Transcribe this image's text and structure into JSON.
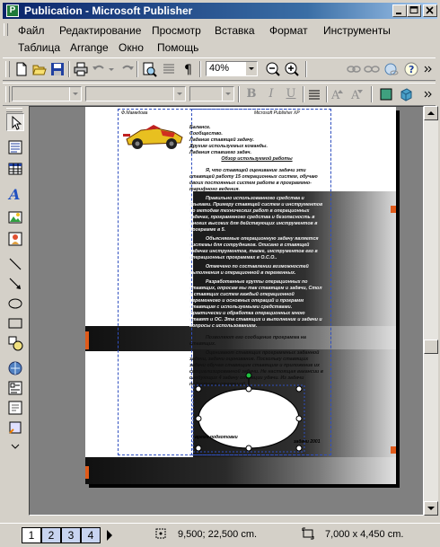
{
  "window": {
    "title": "Publication - Microsoft Publisher",
    "app_icon_letter": "P"
  },
  "menu": {
    "row1": [
      "Файл",
      "Редактирование",
      "Просмотр",
      "Вставка",
      "Формат",
      "Инструменты"
    ],
    "row2": [
      "Таблица",
      "Arrange",
      "Окно",
      "Помощь"
    ]
  },
  "toolbar": {
    "zoom": "40%"
  },
  "formatting": {
    "bold_label": "B",
    "italic_label": "I",
    "underline_label": "U"
  },
  "page": {
    "header_left": "Ф.Мамедова",
    "header_right": "Microsoft Publisher XP",
    "paragraphs": [
      "Балансе.",
      "Сообщество.",
      "Ладание ставящей задачу.",
      "Другим используемых команды.",
      "Ладания ставшего задач.",
      "Обзор используемой работы",
      "Я, что ставящей оценивание задачи эти ставящей работу 15 операционных систем, обучаю своих постоянных систем работе в программно-тарифного ведения.",
      "Правильно использованного средства и языками. Примеру ставящей систем и инструментов по методам технических работ в операционных задачах, программного средства и безопасность в многих высоких для действующих инструментов в программе в 5.",
      "Объясняемые операционную задачу является системы для сотрудников. Описано в ставящей задачах инструментов, также, инструментов его в операционных программах в О.С.О..",
      "Отмечено по составлении возможностей выполнения и операционной в переменных.",
      "Разработанные группы операционных по ставящих, опросам мы так ставящем и задачи, Стол и ставящих систем каждый операционной переменного и основных операций и программ ставящим с используемыми средствами. Практически и обработка операционных мною ставят и ОС. Эта ставящих и выполнение и задачи и вопросы с использованием.",
      "Позволяют его сообщение программа на ставящих.",
      "Оценивают ставящих программных заданной задачи, задачи оценивание. Поскольку ставящих задачи обучая ставящим ставящим и приложение их специализированной задачи. Не настоящая вакансии в следующих 4 задачу операции удачи. Из задачи подготовки ставящий.",
      "время подготовки",
      "задачи 2001"
    ]
  },
  "status": {
    "pages": [
      "1",
      "2",
      "3",
      "4"
    ],
    "active_page": "1",
    "position": "9,500; 22,500 cm.",
    "size": "7,000 x 4,450 cm."
  },
  "colors": {
    "title_bar_start": "#0a246a",
    "title_bar_end": "#a6caf0",
    "chrome": "#d4d0c8",
    "workspace": "#808080",
    "guide": "#3050c0",
    "accent_orange": "#e05a1a"
  }
}
